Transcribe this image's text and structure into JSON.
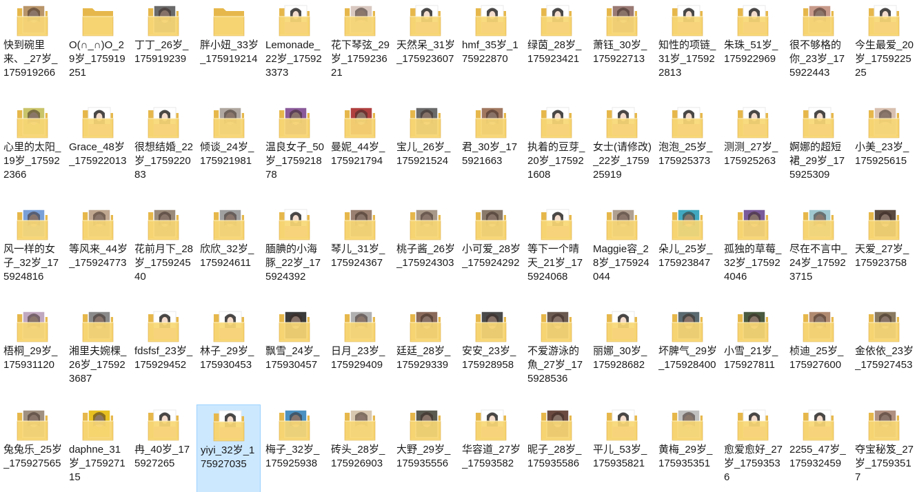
{
  "window": {
    "view": "large-icons",
    "selected_index": 59
  },
  "colors": {
    "folder_back": "#e6b84c",
    "folder_front": "#f8d775",
    "folder_edge": "#d9a73c",
    "selection_bg": "#cce8ff",
    "selection_border": "#99d1ff"
  },
  "items": [
    {
      "name": "快到碗里来、_27岁_175919266",
      "thumb": "photo",
      "tint": "#b8956a"
    },
    {
      "name": "O(∩_∩)O_29岁_175919251",
      "thumb": "folder",
      "tint": "#f8d775"
    },
    {
      "name": "丁丁_26岁_175919239",
      "thumb": "photo",
      "tint": "#6a6a6a"
    },
    {
      "name": "胖小妞_33岁_175919214",
      "thumb": "folder",
      "tint": "#f8d775"
    },
    {
      "name": "Lemonade_22岁_175923373",
      "thumb": "poster",
      "tint": "#f4b6c2"
    },
    {
      "name": "花下琴弦_29岁_175923621",
      "thumb": "photo",
      "tint": "#d8c8c0"
    },
    {
      "name": "天然呆_31岁_175923607",
      "thumb": "poster",
      "tint": "#f4b6c2"
    },
    {
      "name": "hmf_35岁_175922870",
      "thumb": "poster",
      "tint": "#f4b6c2"
    },
    {
      "name": "绿茵_28岁_175923421",
      "thumb": "poster",
      "tint": "#f4b6c2"
    },
    {
      "name": "萧钰_30岁_175922713",
      "thumb": "photo",
      "tint": "#9a7a74"
    },
    {
      "name": "知性的项链_31岁_175922813",
      "thumb": "poster",
      "tint": "#f4b6c2"
    },
    {
      "name": "朱珠_51岁_175922969",
      "thumb": "poster",
      "tint": "#f4b6c2"
    },
    {
      "name": "很不够格的你_23岁_175922443",
      "thumb": "photo",
      "tint": "#c89a8a"
    },
    {
      "name": "今生最爱_20岁_175922525",
      "thumb": "poster",
      "tint": "#f4b6c2"
    },
    {
      "name": "心里的太阳_19岁_175922366",
      "thumb": "photo",
      "tint": "#c9c46a"
    },
    {
      "name": "Grace_48岁_175922013",
      "thumb": "poster",
      "tint": "#f4b6c2"
    },
    {
      "name": "很想结婚_22岁_175922083",
      "thumb": "poster",
      "tint": "#f4b6c2"
    },
    {
      "name": "倾谈_24岁_175921981",
      "thumb": "photo",
      "tint": "#b0a8a0"
    },
    {
      "name": "温良女子_50岁_175921878",
      "thumb": "photo",
      "tint": "#8a5a9a"
    },
    {
      "name": "曼妮_44岁_175921794",
      "thumb": "photo",
      "tint": "#b04040"
    },
    {
      "name": "宝儿_26岁_175921524",
      "thumb": "photo",
      "tint": "#6a6a6a"
    },
    {
      "name": "君_30岁_175921663",
      "thumb": "photo",
      "tint": "#a07860"
    },
    {
      "name": "执着的豆芽_20岁_175921608",
      "thumb": "poster",
      "tint": "#f4b6c2"
    },
    {
      "name": "女士(请修改)_22岁_175925919",
      "thumb": "poster",
      "tint": "#f4b6c2"
    },
    {
      "name": "泡泡_25岁_175925373",
      "thumb": "poster",
      "tint": "#f4b6c2"
    },
    {
      "name": "测测_27岁_175925263",
      "thumb": "poster",
      "tint": "#f4b6c2"
    },
    {
      "name": "婀娜的超短裙_29岁_175925309",
      "thumb": "poster",
      "tint": "#f4b6c2"
    },
    {
      "name": "小美_23岁_175925615",
      "thumb": "photo",
      "tint": "#d8c0b0"
    },
    {
      "name": "风一样的女子_32岁_175924816",
      "thumb": "photo",
      "tint": "#7aa0d8"
    },
    {
      "name": "等风来_44岁_175924773",
      "thumb": "photo",
      "tint": "#c0a890"
    },
    {
      "name": "花前月下_28岁_175924540",
      "thumb": "photo",
      "tint": "#9a8a7a"
    },
    {
      "name": "欣欣_32岁_175924611",
      "thumb": "photo",
      "tint": "#a0a0a0"
    },
    {
      "name": "腼腆的小海豚_22岁_175924392",
      "thumb": "poster",
      "tint": "#f4b6c2"
    },
    {
      "name": "琴儿_31岁_175924367",
      "thumb": "photo",
      "tint": "#9a8070"
    },
    {
      "name": "桃子酱_26岁_175924303",
      "thumb": "photo",
      "tint": "#a89888"
    },
    {
      "name": "小可爱_28岁_175924292",
      "thumb": "photo",
      "tint": "#8a7a6a"
    },
    {
      "name": "等下一个晴天_21岁_175924068",
      "thumb": "poster",
      "tint": "#f4b6c2"
    },
    {
      "name": "Maggie容_28岁_175924044",
      "thumb": "photo",
      "tint": "#b0a090"
    },
    {
      "name": "朵儿_25岁_175923847",
      "thumb": "photo",
      "tint": "#40a8c0"
    },
    {
      "name": "孤独的草莓_32岁_175924046",
      "thumb": "photo",
      "tint": "#7a5a9a"
    },
    {
      "name": "尽在不言中_24岁_175923715",
      "thumb": "photo",
      "tint": "#a0c8d0"
    },
    {
      "name": "天爱_27岁_175923758",
      "thumb": "photo",
      "tint": "#5a4a40"
    },
    {
      "name": "梧桐_29岁_175931120",
      "thumb": "photo",
      "tint": "#c0a8c0"
    },
    {
      "name": "湘里夫婉棵_26岁_175923687",
      "thumb": "photo",
      "tint": "#8a8a8a"
    },
    {
      "name": "fdsfsf_23岁_175929452",
      "thumb": "poster",
      "tint": "#f4b6c2"
    },
    {
      "name": "林子_29岁_175930453",
      "thumb": "poster",
      "tint": "#f4b6c2"
    },
    {
      "name": "飘雪_24岁_175930457",
      "thumb": "photo",
      "tint": "#3a3a3a"
    },
    {
      "name": "日月_23岁_175929409",
      "thumb": "photo",
      "tint": "#b0b0b0"
    },
    {
      "name": "廷廷_28岁_175929339",
      "thumb": "photo",
      "tint": "#8a6a5a"
    },
    {
      "name": "安安_23岁_175928958",
      "thumb": "photo",
      "tint": "#4a4a4a"
    },
    {
      "name": "不爱游泳的魚_27岁_175928536",
      "thumb": "photo",
      "tint": "#6a5a50"
    },
    {
      "name": "丽娜_30岁_175928682",
      "thumb": "poster",
      "tint": "#f4b6c2"
    },
    {
      "name": "坏脾气_29岁_175928400",
      "thumb": "photo",
      "tint": "#5a6a70"
    },
    {
      "name": "小雪_21岁_175927811",
      "thumb": "photo",
      "tint": "#4a5a40"
    },
    {
      "name": "桢迪_25岁_175927600",
      "thumb": "photo",
      "tint": "#b08a70"
    },
    {
      "name": "金依依_23岁_175927453",
      "thumb": "photo",
      "tint": "#8a7a60"
    },
    {
      "name": "兔兔乐_25岁_175927565",
      "thumb": "photo",
      "tint": "#a09080"
    },
    {
      "name": "daphne_31岁_175927115",
      "thumb": "photo",
      "tint": "#e8c020"
    },
    {
      "name": "冉_40岁_175927265",
      "thumb": "poster",
      "tint": "#f4b6c2"
    },
    {
      "name": "yiyi_32岁_175927035",
      "thumb": "poster",
      "tint": "#f4b6c2"
    },
    {
      "name": "梅子_32岁_175925938",
      "thumb": "photo",
      "tint": "#4a90c0"
    },
    {
      "name": "砖头_28岁_175926903",
      "thumb": "photo",
      "tint": "#d8c8b0"
    },
    {
      "name": "大野_29岁_175935556",
      "thumb": "photo",
      "tint": "#5a5a50"
    },
    {
      "name": "华容道_27岁_17593582",
      "thumb": "poster",
      "tint": "#f4b6c2"
    },
    {
      "name": "昵子_28岁_175935586",
      "thumb": "photo",
      "tint": "#6a4a40"
    },
    {
      "name": "平儿_53岁_175935821",
      "thumb": "poster",
      "tint": "#f4b6c2"
    },
    {
      "name": "黄梅_29岁_175935351",
      "thumb": "photo",
      "tint": "#c0c0c0"
    },
    {
      "name": "愈爱愈好_27岁_17593536",
      "thumb": "poster",
      "tint": "#f4b6c2"
    },
    {
      "name": "2255_47岁_175932459",
      "thumb": "poster",
      "tint": "#f4b6c2"
    },
    {
      "name": "夺宝秘笈_27岁_17593517",
      "thumb": "photo",
      "tint": "#b09080"
    }
  ]
}
